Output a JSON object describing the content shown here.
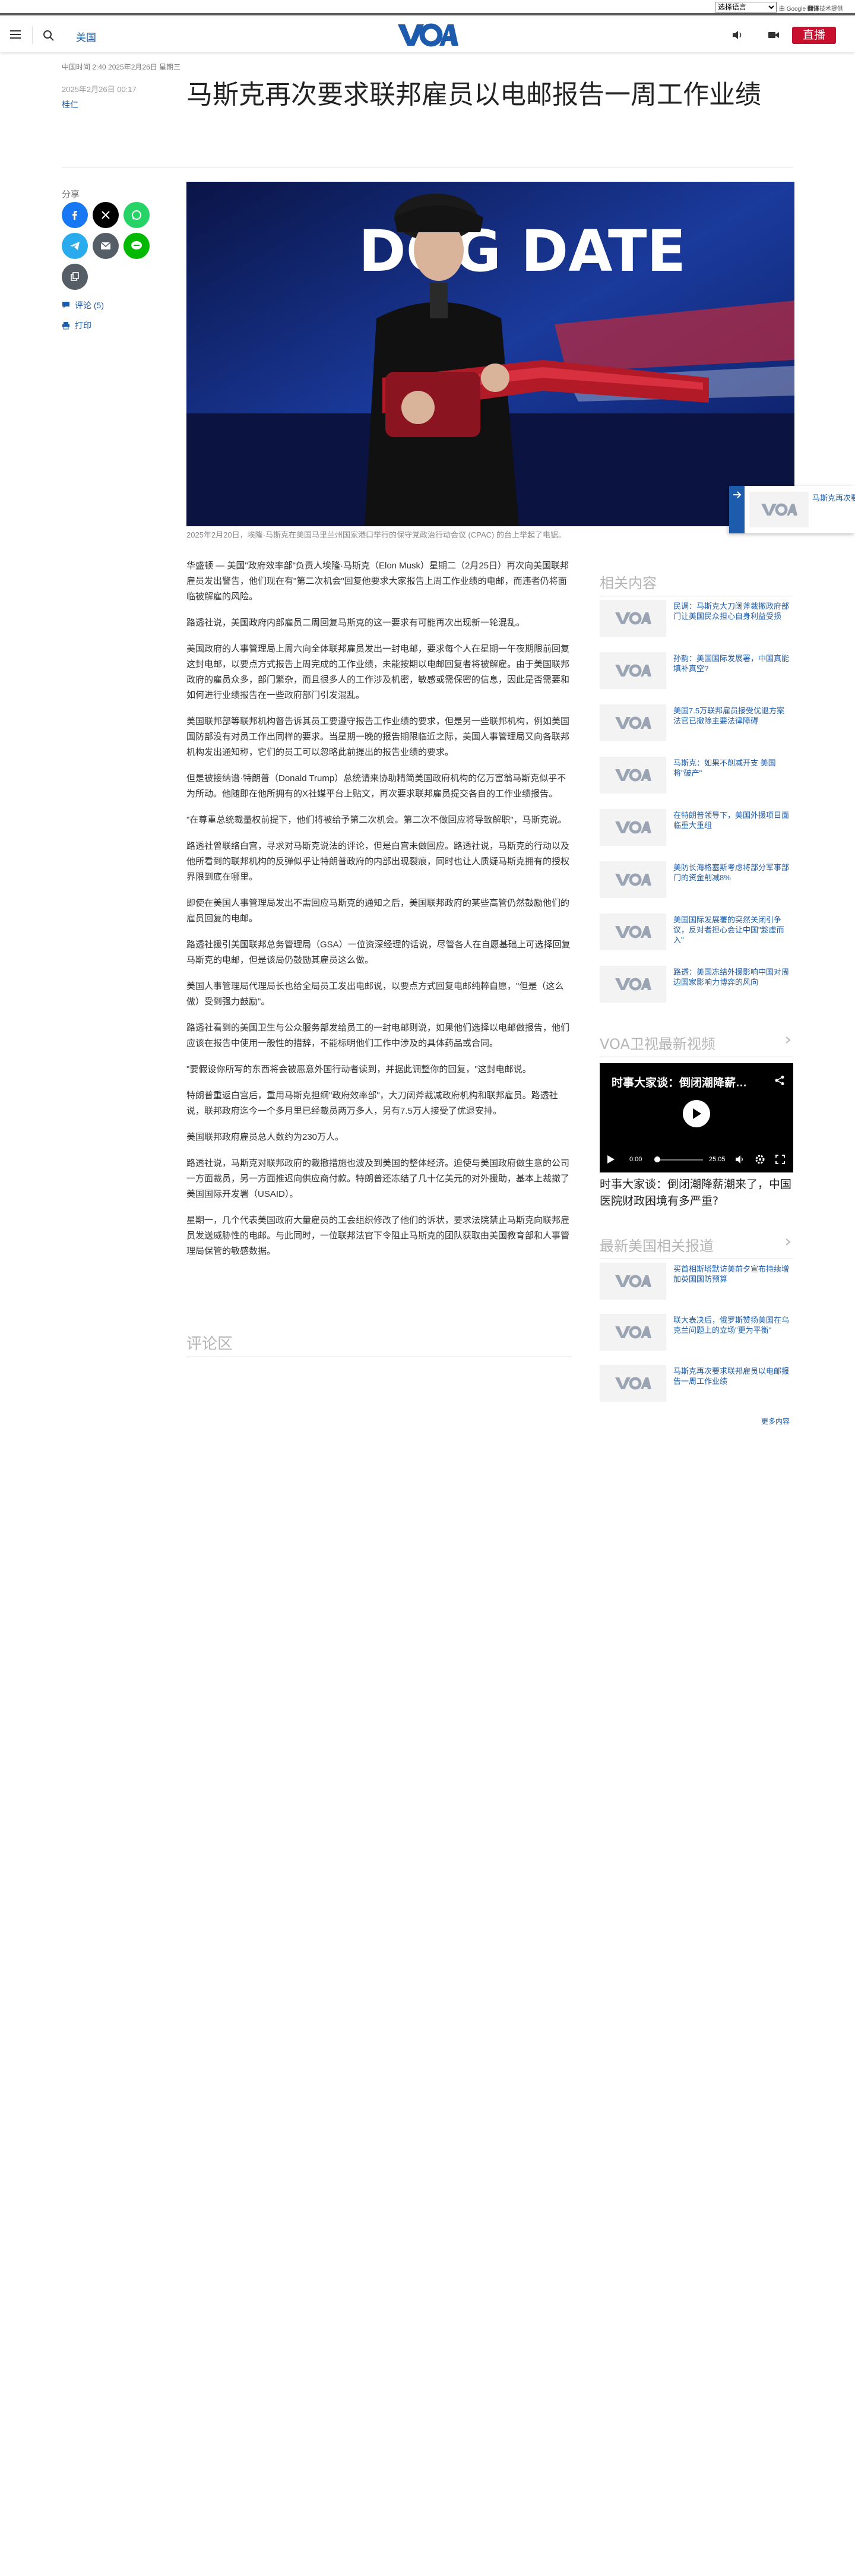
{
  "utility": {
    "language_select": "选择语言",
    "google_powered": "由 Google",
    "google_translate": "翻译",
    "google_suffix": "技术提供"
  },
  "header": {
    "section": "美国",
    "live": "直播",
    "brand_color": "#1d5cac",
    "live_color": "#c8102e"
  },
  "article": {
    "dateline": "中国时间 2:40 2025年2月26日 星期三",
    "date": "2025年2月26日 00:17",
    "author": "桂仁",
    "title": "马斯克再次要求联邦雇员以电邮报告一周工作业绩",
    "image": {
      "sign_text": "DOG  DATE",
      "caption": "2025年2月20日，埃隆·马斯克在美国马里兰州国家港口举行的保守党政治行动会议 (CPAC) 的台上举起了电锯。"
    },
    "paragraphs": [
      "华盛顿 — 美国\"政府效率部\"负责人埃隆·马斯克（Elon Musk）星期二（2月25日）再次向美国联邦雇员发出警告，他们现在有\"第二次机会\"回复他要求大家报告上周工作业绩的电邮，而违者仍将面临被解雇的风险。",
      "路透社说，美国政府内部雇员二周回复马斯克的这一要求有可能再次出现新一轮混乱。",
      "美国政府的人事管理局上周六向全体联邦雇员发出一封电邮，要求每个人在星期一午夜期限前回复这封电邮，以要点方式报告上周完成的工作业绩，未能按期以电邮回复者将被解雇。由于美国联邦政府的雇员众多，部门繁杂，而且很多人的工作涉及机密，敏感或需保密的信息，因此是否需要和如何进行业绩报告在一些政府部门引发混乱。",
      "美国联邦部等联邦机构督告诉其员工要遵守报告工作业绩的要求，但是另一些联邦机构，例如美国国防部没有对员工作出同样的要求。当星期一晚的报告期限临近之际，美国人事管理局又向各联邦机构发出通知称，它们的员工可以忽略此前提出的报告业绩的要求。",
      "但是被接纳谱·特朗普（Donald Trump）总统请来协助精简美国政府机构的亿万富翁马斯克似乎不为所动。他随即在他所拥有的X社媒平台上贴文，再次要求联邦雇员提交各自的工作业绩报告。",
      "\"在尊重总统裁量权前提下，他们将被给予第二次机会。第二次不做回应将导致解职\"，马斯克说。",
      "路透社曾联络白宫，寻求对马斯克说法的评论，但是白宫未做回应。路透社说，马斯克的行动以及他所看到的联邦机构的反弹似乎让特朗普政府的内部出现裂痕，同时也让人质疑马斯克拥有的授权界限到底在哪里。",
      "即使在美国人事管理局发出不需回应马斯克的通知之后，美国联邦政府的某些高管仍然鼓励他们的雇员回复的电邮。",
      "路透社援引美国联邦总务管理局（GSA）一位资深经理的话说，尽管各人在自愿基础上可选择回复马斯克的电邮，但是该局仍鼓励其雇员这么做。",
      "美国人事管理局代理局长也给全局员工发出电邮说，以要点方式回复电邮纯粹自愿，\"但是（这么做）受到强力鼓励\"。",
      "路透社看到的美国卫生与公众服务部发给员工的一封电邮则说，如果他们选择以电邮做报告，他们应该在报告中使用一般性的措辞，不能标明他们工作中涉及的具体药品或合同。",
      "\"要假设你所写的东西将会被恶意外国行动者读到，并据此调整你的回复，\"这封电邮说。",
      "特朗普重返白宫后，重用马斯克担纲\"政府效率部\"，大刀阔斧裁减政府机构和联邦雇员。路透社说，联邦政府迄今一个多月里已经裁员两万多人，另有7.5万人接受了优退安排。",
      "美国联邦政府雇员总人数约为230万人。",
      "路透社说，马斯克对联邦政府的裁撤措施也波及到美国的整体经济。迫使与美国政府做生意的公司一方面裁员，另一方面推迟向供应商付款。特朗普还冻结了几十亿美元的对外援助，基本上裁撤了美国国际开发署（USAID）。",
      "星期一，几个代表美国政府大量雇员的工会组织修改了他们的诉状，要求法院禁止马斯克向联邦雇员发送威胁性的电邮。与此同时，一位联邦法官下令阻止马斯克的团队获取由美国教育部和人事管理局保管的敏感数据。"
    ],
    "comments_heading": "评论区"
  },
  "share": {
    "label": "分享",
    "comments_link": "评论 (5)",
    "print_link": "打印"
  },
  "sidebar": {
    "related_heading": "相关内容",
    "related": [
      "民调：马斯克大刀阔斧裁撤政府部门让美国民众担心自身利益受损",
      "孙韵：美国国际发展署，中国真能填补真空?",
      "美国7.5万联邦雇员接受优退方案 法官已撤除主要法律障碍",
      "马斯克：如果不削减开支 美国将\"破产\"",
      "在特朗普领导下，美国外援项目面临重大重组",
      "美防长海格塞斯考虑将部分军事部门的资金削减8%",
      "美国国际发展署的突然关闭引争议，反对者担心会让中国\"趁虚而入\"",
      "路透：美国冻结外援影响中国对周边国家影响力博弈的风向"
    ],
    "video_heading": "VOA卫视最新视频",
    "video": {
      "title": "时事大家谈：倒闭潮降薪…",
      "time_current": "0:00",
      "time_total": "25:05",
      "caption": "时事大家谈：倒闭潮降薪潮来了，中国医院财政困境有多严重?"
    },
    "latest_heading": "最新美国相关报道",
    "latest": [
      "买首相斯塔默访美前夕宣布持续增加英国国防预算",
      "联大表决后，俄罗斯赞扬美国在乌克兰问题上的立场\"更为平衡\"",
      "马斯克再次要求联邦雇员以电邮报告一周工作业绩"
    ],
    "more": "更多内容"
  },
  "floating_next": {
    "title": "马斯克再次要求联邦雇员以电邮报告一周工作业绩"
  }
}
